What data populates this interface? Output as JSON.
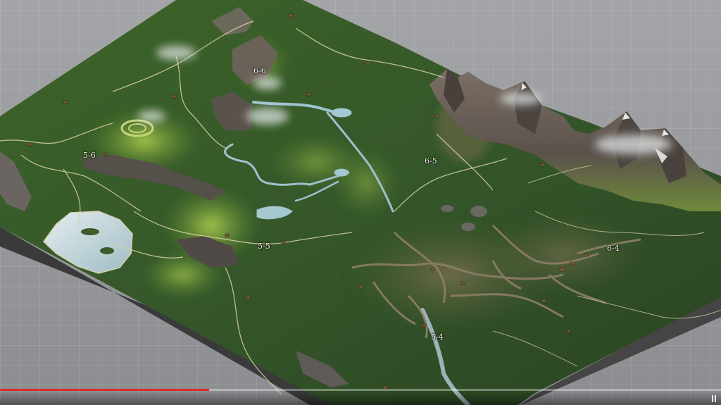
{
  "map": {
    "region_labels": [
      {
        "id": "label-5-6",
        "text": "5-6"
      },
      {
        "id": "label-6-6",
        "text": "6-6"
      },
      {
        "id": "label-6-5",
        "text": "6-5"
      },
      {
        "id": "label-5-5",
        "text": "5-5"
      },
      {
        "id": "label-6-4",
        "text": "6-4"
      },
      {
        "id": "label-5-4",
        "text": "5-4"
      }
    ]
  },
  "player": {
    "progress": 0.29,
    "colors": {
      "progress_fill": "#e02c2c",
      "progress_track": "#d8d8d8"
    },
    "icons": [
      "pause-icon"
    ]
  },
  "colors": {
    "background_grid": "#9a9c9f",
    "forest_dark": "#2f4a22",
    "forest": "#3f6a2c",
    "meadow": "#8fb443",
    "path_light": "#d7cfa4",
    "path_dirt": "#8a7a60",
    "water": "#9ec2cc",
    "lake": "#cfe2e6",
    "rock": "#5e5a56",
    "snow": "#e6e6e6",
    "cliff_side": "#3c3c3c"
  }
}
